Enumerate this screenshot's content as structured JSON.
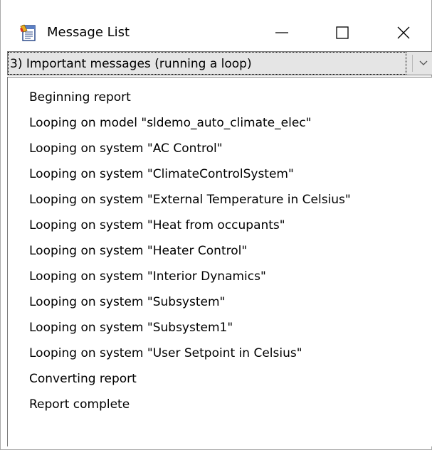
{
  "window": {
    "title": "Message List",
    "icon": "message-list-app-icon",
    "controls": {
      "minimize_icon": "minimize-icon",
      "maximize_icon": "maximize-icon",
      "close_icon": "close-icon"
    }
  },
  "filter": {
    "selected": "3) Important messages (running a loop)",
    "arrow_icon": "chevron-down-icon"
  },
  "messages": [
    "Beginning report",
    "Looping on model \"sldemo_auto_climate_elec\"",
    "Looping on system \"AC Control\"",
    "Looping on system \"ClimateControlSystem\"",
    "Looping on system \"External Temperature in Celsius\"",
    "Looping on system \"Heat from occupants\"",
    "Looping on system \"Heater Control\"",
    "Looping on system \"Interior Dynamics\"",
    "Looping on system \"Subsystem\"",
    "Looping on system \"Subsystem1\"",
    "Looping on system \"User Setpoint in Celsius\"",
    "Converting report",
    "Report complete"
  ]
}
